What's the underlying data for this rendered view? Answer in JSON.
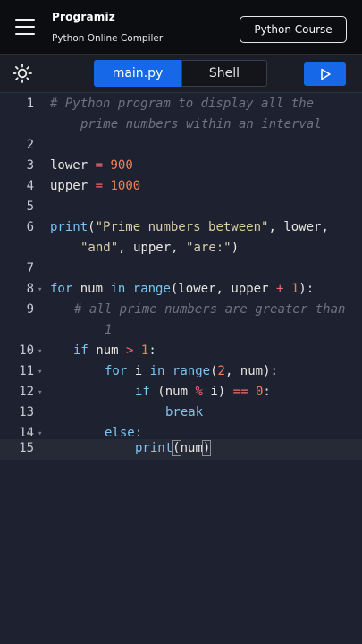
{
  "header": {
    "logo_text": "Programiz",
    "subtitle": "Python Online Compiler",
    "course_button": "Python Course"
  },
  "toolbar": {
    "tabs": [
      "main.py",
      "Shell"
    ],
    "active_tab": "main.py"
  },
  "editor": {
    "line_numbers": [
      "1",
      "2",
      "3",
      "4",
      "5",
      "6",
      "7",
      "8",
      "9",
      "10",
      "11",
      "12",
      "13",
      "14",
      "15"
    ],
    "comment1_a": "# Python program to display all the",
    "comment1_b": "prime numbers within an interval",
    "lower": "lower",
    "upper": "upper",
    "eq": "=",
    "v900": "900",
    "v1000": "1000",
    "print": "print",
    "str1": "\"Prime numbers between\"",
    "str_and": "\"and\"",
    "str_are": "\"are:\"",
    "for": "for",
    "num": "num",
    "in": "in",
    "range": "range",
    "plus": "+",
    "one": "1",
    "comment9_a": "# all prime numbers are greater than",
    "comment9_b": "1",
    "if": "if",
    "gt": ">",
    "i": "i",
    "two": "2",
    "mod": "%",
    "eqeq": "==",
    "zero": "0",
    "break": "break",
    "else": "else:"
  },
  "colors": {
    "accent": "#1768e8",
    "header_bg": "#0c0d11",
    "editor_bg": "#1e2230"
  }
}
